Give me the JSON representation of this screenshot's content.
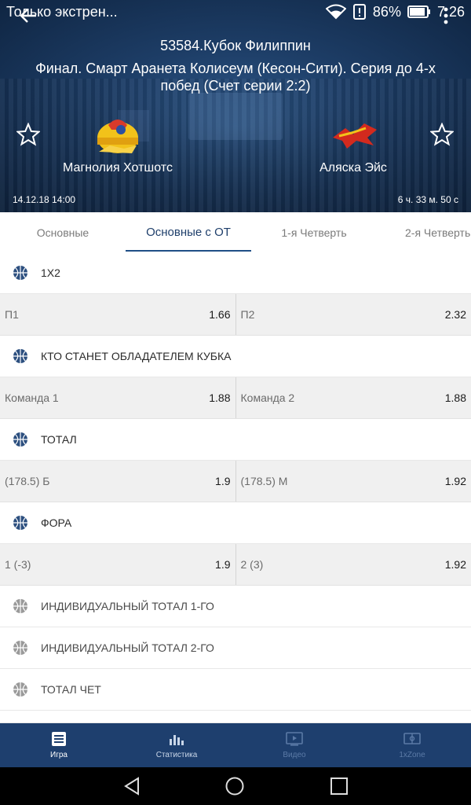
{
  "status_bar": {
    "notification": "Только экстрен...",
    "battery": "86%",
    "time": "7:26"
  },
  "header": {
    "event_id": "53584.Кубок Филиппин",
    "event_subtitle": "Финал. Смарт Аранета Колисеум (Кесон-Сити). Серия до 4-х побед (Счет серии 2:2)",
    "team1": "Магнолия Хотшотс",
    "team2": "Аляска Эйс",
    "date": "14.12.18 14:00",
    "countdown": "6 ч. 33 м. 50 с"
  },
  "tabs": [
    "Основные",
    "Основные с ОТ",
    "1-я Четверть",
    "2-я Четверть"
  ],
  "markets": [
    {
      "title": "1X2",
      "odds": [
        {
          "label": "П1",
          "value": "1.66"
        },
        {
          "label": "П2",
          "value": "2.32"
        }
      ]
    },
    {
      "title": "КТО СТАНЕТ ОБЛАДАТЕЛЕМ КУБКА",
      "odds": [
        {
          "label": "Команда 1",
          "value": "1.88"
        },
        {
          "label": "Команда 2",
          "value": "1.88"
        }
      ]
    },
    {
      "title": "ТОТАЛ",
      "odds": [
        {
          "label": "(178.5) Б",
          "value": "1.9"
        },
        {
          "label": "(178.5) М",
          "value": "1.92"
        }
      ]
    },
    {
      "title": "ФОРА",
      "odds": [
        {
          "label": "1 (-3)",
          "value": "1.9"
        },
        {
          "label": "2 (3)",
          "value": "1.92"
        }
      ]
    },
    {
      "title": "ИНДИВИДУАЛЬНЫЙ ТОТАЛ 1-ГО",
      "odds": []
    },
    {
      "title": "ИНДИВИДУАЛЬНЫЙ ТОТАЛ 2-ГО",
      "odds": []
    },
    {
      "title": "ТОТАЛ ЧЕТ",
      "odds": []
    }
  ],
  "bottom_nav": [
    {
      "label": "Игра",
      "icon": "game-list-icon"
    },
    {
      "label": "Статистика",
      "icon": "bar-chart-icon"
    },
    {
      "label": "Видео",
      "icon": "video-icon"
    },
    {
      "label": "1xZone",
      "icon": "zone-field-icon"
    }
  ],
  "colors": {
    "accent": "#1e3f6e",
    "tab_active": "#1f3f6b",
    "odds_bg": "#f0f0f0"
  }
}
